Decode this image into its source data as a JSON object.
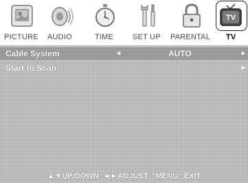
{
  "tabs": [
    {
      "label": "PICTURE",
      "icon": "picture-icon",
      "selected": false
    },
    {
      "label": "AUDIO",
      "icon": "speaker-icon",
      "selected": false
    },
    {
      "label": "TIME",
      "icon": "stopwatch-icon",
      "selected": false
    },
    {
      "label": "SET UP",
      "icon": "tools-icon",
      "selected": false
    },
    {
      "label": "PARENTAL",
      "icon": "lock-icon",
      "selected": false
    },
    {
      "label": "TV",
      "icon": "tv-icon",
      "icon_text": "TV",
      "selected": true
    }
  ],
  "menu": {
    "items": [
      {
        "label": "Cable System",
        "value": "AUTO",
        "left_arrow": "◄",
        "right_arrow": "►",
        "highlighted": true
      },
      {
        "label": "Start to Scan",
        "value": "",
        "right_arrow": "►",
        "highlighted": false
      }
    ]
  },
  "footer": {
    "updown_arrows": "▲▼",
    "updown_label": "UP/DOWN",
    "adjust_arrows": "◄►",
    "adjust_label": "ADJUST",
    "exit_label": "\"MENU\":EXIT"
  },
  "colors": {
    "panel_bg": "#b8b8b8",
    "highlight_bg": "#9a9a9a",
    "text": "#ffffff"
  }
}
